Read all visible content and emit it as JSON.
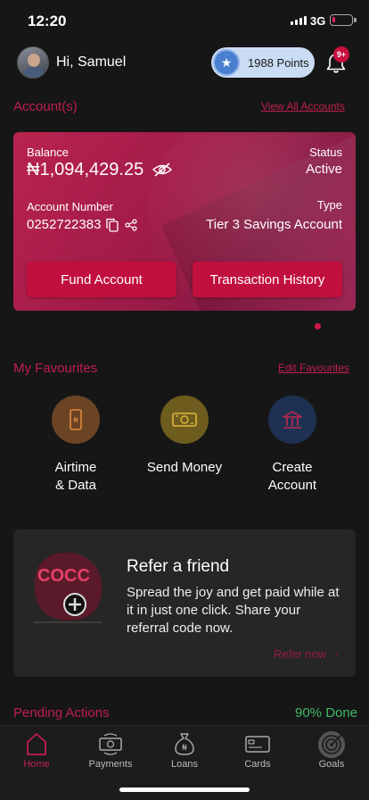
{
  "status_bar": {
    "time": "12:20",
    "network": "3G"
  },
  "header": {
    "greeting": "Hi, Samuel",
    "points": "1988 Points",
    "notification_badge": "9+"
  },
  "accounts": {
    "title": "Account(s)",
    "view_all": "View All Accounts",
    "card": {
      "balance_label": "Balance",
      "balance": "₦1,094,429.25",
      "status_label": "Status",
      "status": "Active",
      "account_number_label": "Account Number",
      "account_number": "0252722383",
      "type_label": "Type",
      "type": "Tier 3 Savings Account",
      "fund_button": "Fund Account",
      "history_button": "Transaction History"
    }
  },
  "favourites": {
    "title": "My Favourites",
    "edit": "Edit Favourites",
    "items": [
      {
        "label_line1": "Airtime",
        "label_line2": "& Data",
        "icon": "phone-icon",
        "color": "#6b4424"
      },
      {
        "label_line1": "Send Money",
        "label_line2": "",
        "icon": "money-icon",
        "color": "#6e5c1e"
      },
      {
        "label_line1": "Create",
        "label_line2": "Account",
        "icon": "bank-icon",
        "color": "#1f3152"
      }
    ]
  },
  "referral": {
    "logo_text": "COCC",
    "title": "Refer a friend",
    "text": "Spread the joy and get paid while at it in just one click. Share your referral code now.",
    "cta": "Refer now"
  },
  "pending": {
    "label": "Pending Actions",
    "progress": "90% Done"
  },
  "tabs": [
    {
      "label": "Home",
      "icon": "home-icon",
      "active": true
    },
    {
      "label": "Payments",
      "icon": "payments-icon",
      "active": false
    },
    {
      "label": "Loans",
      "icon": "loans-icon",
      "active": false
    },
    {
      "label": "Cards",
      "icon": "cards-icon",
      "active": false
    },
    {
      "label": "Goals",
      "icon": "goals-icon",
      "active": false
    }
  ],
  "colors": {
    "accent": "#c01e4d",
    "card": "#b9234f",
    "button": "#c1103e",
    "success": "#3fb865",
    "background": "#161616"
  }
}
